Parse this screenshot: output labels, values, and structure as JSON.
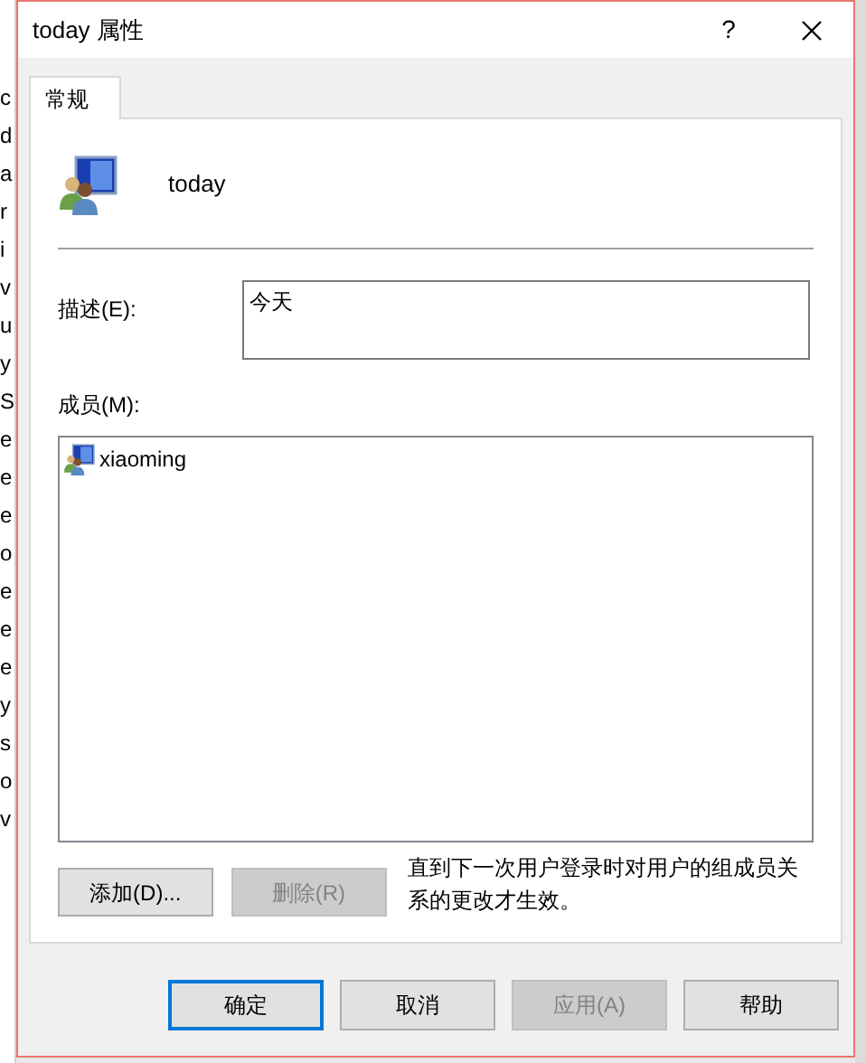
{
  "background_window": {
    "fragments": [
      "c",
      "d",
      "a",
      "r",
      "i",
      "v",
      "u",
      "y",
      "S",
      "e",
      "e",
      "e",
      "o",
      "e",
      "e",
      "e",
      "y",
      "s",
      "o",
      "v"
    ]
  },
  "window": {
    "title": "today 属性",
    "help": "?"
  },
  "tabs": [
    {
      "label": "常规",
      "selected": true
    }
  ],
  "group": {
    "name": "today"
  },
  "description": {
    "label": "描述(E):",
    "value": "今天"
  },
  "members": {
    "label": "成员(M):",
    "items": [
      {
        "name": "xiaoming",
        "selected": false
      }
    ]
  },
  "member_buttons": [
    {
      "label": "添加(D)...",
      "disabled": false
    },
    {
      "label": "删除(R)",
      "disabled": true
    }
  ],
  "note": "直到下一次用户登录时对用户的组成员关系的更改才生效。",
  "buttons": [
    {
      "label": "确定",
      "disabled": false,
      "focused": true
    },
    {
      "label": "取消",
      "disabled": false,
      "focused": false
    },
    {
      "label": "应用(A)",
      "disabled": true,
      "focused": false
    },
    {
      "label": "帮助",
      "disabled": false,
      "focused": false
    }
  ]
}
